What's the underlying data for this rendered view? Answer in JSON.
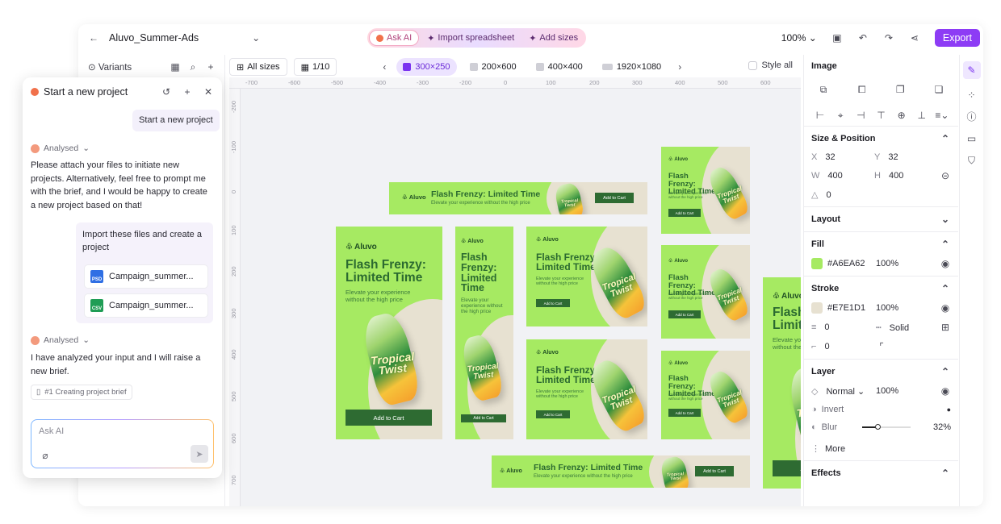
{
  "topbar": {
    "back_icon": "arrow-left-icon",
    "doc_name": "Aluvo_Summer-Ads",
    "ai_tools": {
      "ask_ai": "Ask AI",
      "import_spreadsheet": "Import spreadsheet",
      "add_sizes": "Add sizes"
    },
    "zoom": "100%",
    "export_label": "Export"
  },
  "left_panel": {
    "variants_label": "Variants"
  },
  "canvas_toolbar": {
    "all_sizes": "All sizes",
    "page_counter": "1/10",
    "sizes": [
      "300×250",
      "200×600",
      "400×400",
      "1920×1080"
    ],
    "active_size_index": 0,
    "style_all": "Style all"
  },
  "rulers": {
    "horizontal": [
      "-700",
      "-600",
      "-500",
      "-400",
      "-300",
      "-200",
      "0",
      "100",
      "200",
      "300",
      "400",
      "500",
      "600"
    ],
    "vertical": [
      "-200",
      "-100",
      "0",
      "100",
      "200",
      "300",
      "400",
      "500",
      "600",
      "700"
    ]
  },
  "ad_copy": {
    "brand": "Aluvo",
    "headline": "Flash Frenzy: Limited Time",
    "headline_line1": "Flash Frenzy:",
    "headline_line2": "Limited Time",
    "subline": "Elevate your experience without the high price",
    "cta": "Add to Cart",
    "can_text_1": "Tropical",
    "can_text_2": "Twist"
  },
  "right_panel": {
    "image_title": "Image",
    "size_position_title": "Size & Position",
    "x_label": "X",
    "x": "32",
    "y_label": "Y",
    "y": "32",
    "w_label": "W",
    "w": "400",
    "h_label": "H",
    "h": "400",
    "rotation": "0",
    "layout_title": "Layout",
    "fill_title": "Fill",
    "fill_hex": "#A6EA62",
    "fill_opacity": "100%",
    "stroke_title": "Stroke",
    "stroke_hex": "#E7E1D1",
    "stroke_opacity": "100%",
    "stroke_width": "0",
    "stroke_style": "Solid",
    "corner_radius": "0",
    "layer_title": "Layer",
    "blend_mode": "Normal",
    "layer_opacity": "100%",
    "invert_label": "Invert",
    "blur_label": "Blur",
    "blur_value": "32%",
    "blur_fraction": 0.32,
    "more_label": "More",
    "effects_title": "Effects"
  },
  "chat": {
    "title": "Start a new project",
    "user_msg_1": "Start a new project",
    "analysed_label": "Analysed",
    "assistant_msg_1": "Please attach your files to initiate new projects. Alternatively, feel free to prompt me with the brief, and I would be happy to create a new project based on that!",
    "user_msg_2": "Import these files and create a project",
    "files": [
      {
        "type": "PSD",
        "name": "Campaign_summer..."
      },
      {
        "type": "CSV",
        "name": "Campaign_summer..."
      }
    ],
    "assistant_msg_2": "I have analyzed your input and I will raise a new brief.",
    "brief_chip": "#1 Creating project brief",
    "input_placeholder": "Ask AI"
  },
  "colors": {
    "accent": "#8d3cf5",
    "ad_green": "#A6EA62",
    "ad_cream": "#E7E1D1",
    "ad_dark": "#2e6b32"
  }
}
